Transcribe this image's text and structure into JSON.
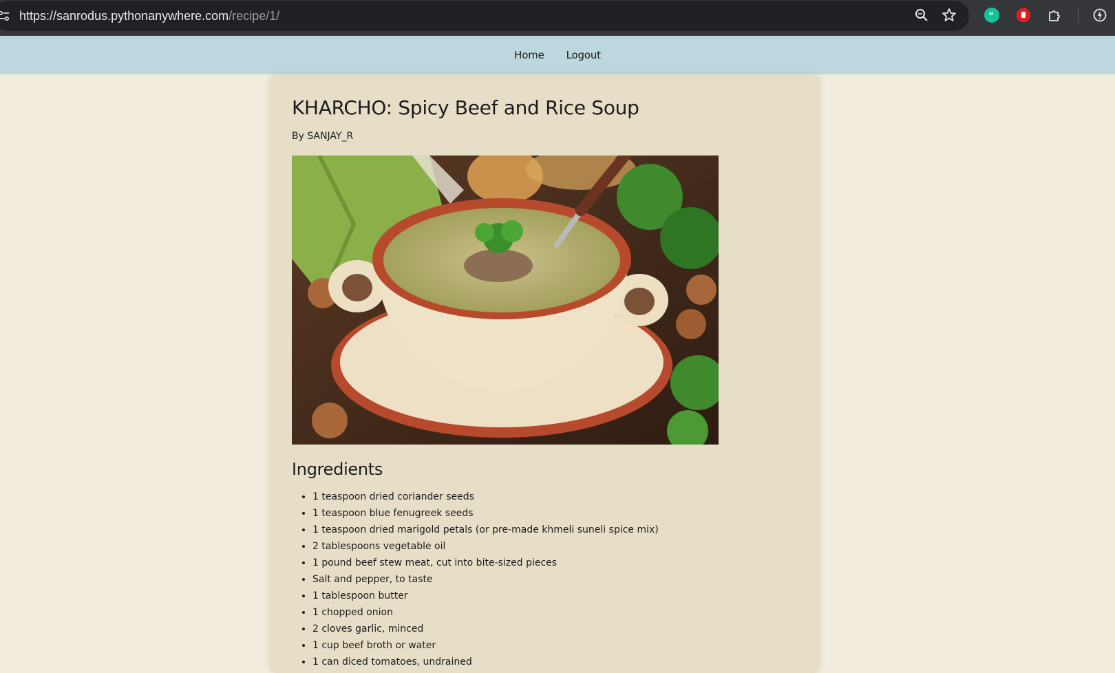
{
  "browser": {
    "url_host": "https://sanrodus.pythonanywhere.com",
    "url_path": "/recipe/1/",
    "icons": [
      "site-info-icon",
      "zoom-icon",
      "star-icon",
      "grammarly-extension-icon",
      "adblock-extension-icon",
      "extensions-puzzle-icon",
      "performance-icon"
    ]
  },
  "nav": {
    "home_label": "Home",
    "logout_label": "Logout"
  },
  "recipe": {
    "title": "KHARCHO: Spicy Beef and Rice Soup",
    "author": "By SANJAY_R",
    "ingredients_heading": "Ingredients",
    "ingredients": [
      "1 teaspoon dried coriander seeds",
      "1 teaspoon blue fenugreek seeds",
      "1 teaspoon dried marigold petals (or pre-made khmeli suneli spice mix)",
      "2 tablespoons vegetable oil",
      "1 pound beef stew meat, cut into bite-sized pieces",
      "Salt and pepper, to taste",
      "1 tablespoon butter",
      "1 chopped onion",
      "2 cloves garlic, minced",
      "1 cup beef broth or water",
      "1 can diced tomatoes, undrained"
    ]
  },
  "colors": {
    "page_bg": "#f1ecdb",
    "nav_bg": "#bdd7de",
    "card_bg": "#e6dec6",
    "browser_bg": "#202124"
  }
}
